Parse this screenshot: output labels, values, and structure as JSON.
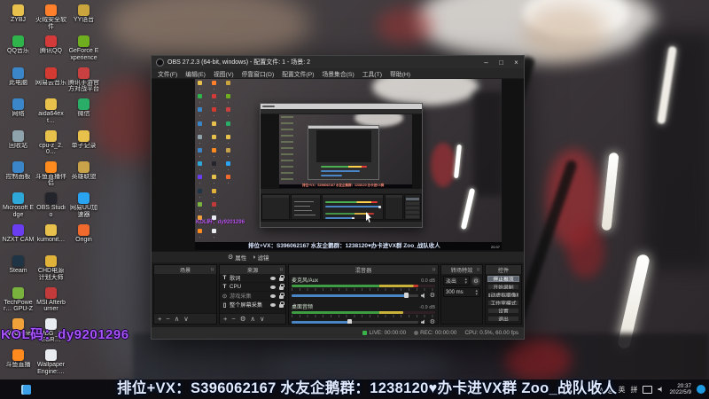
{
  "desktop": {
    "icons": [
      {
        "label": "ZYBJ",
        "color": "#e8c14d"
      },
      {
        "label": "QQ音乐",
        "color": "#2fb44c"
      },
      {
        "label": "此电脑",
        "color": "#3a86c8"
      },
      {
        "label": "网络",
        "color": "#3a86c8"
      },
      {
        "label": "回收站",
        "color": "#8fa3ad"
      },
      {
        "label": "控制面板",
        "color": "#3a86c8"
      },
      {
        "label": "Microsoft Edge",
        "color": "#2ea7d9"
      },
      {
        "label": "NZXT CAM",
        "color": "#6a3df0"
      },
      {
        "label": "Steam",
        "color": "#1f3445"
      },
      {
        "label": "TechPower… GPU-Z",
        "color": "#79b33e"
      },
      {
        "label": "WeGame",
        "color": "#f0a23a"
      },
      {
        "label": "斗鱼直播",
        "color": "#ff8a1e"
      },
      {
        "label": "火绒安全软件",
        "color": "#ff7f2a"
      },
      {
        "label": "腾讯QQ",
        "color": "#d43a3a"
      },
      {
        "label": "网易云音乐",
        "color": "#d33a31"
      },
      {
        "label": "aida64ext…",
        "color": "#e8c14d"
      },
      {
        "label": "cpu-z_2.0…",
        "color": "#e8c14d"
      },
      {
        "label": "斗鱼直播伴侣",
        "color": "#ff8a1e"
      },
      {
        "label": "OBS Studio",
        "color": "#24242c"
      },
      {
        "label": "kumonit…",
        "color": "#e8c14d"
      },
      {
        "label": "CHD电源计划大师",
        "color": "#e0b23a"
      },
      {
        "label": "MSI Afterburner",
        "color": "#c23a3a"
      },
      {
        "label": "PUBG _TLEGR…",
        "color": "#e9edf2"
      },
      {
        "label": "Wallpaper Engine:…",
        "color": "#e9edf2"
      },
      {
        "label": "YY语音",
        "color": "#caa53d"
      },
      {
        "label": "GeForce Experience",
        "color": "#6fae1f"
      },
      {
        "label": "腾讯手游官方对战平台",
        "color": "#c94040"
      },
      {
        "label": "微信",
        "color": "#2aae67"
      },
      {
        "label": "单子记录",
        "color": "#e8c14d"
      },
      {
        "label": "英雄联盟",
        "color": "#c9a34a"
      },
      {
        "label": "网易UU加速器",
        "color": "#2aa3f0"
      },
      {
        "label": "Origin",
        "color": "#f06a2d"
      }
    ],
    "kol_text": "KOL码：dy9201296"
  },
  "obs": {
    "title": "OBS 27.2.3 (64-bit, windows) - 配置文件: 1 - 场景: 2",
    "window_buttons": {
      "min": "–",
      "max": "□",
      "close": "×"
    },
    "menus": [
      "文件(F)",
      "编辑(E)",
      "视图(V)",
      "停靠窗口(D)",
      "配置文件(P)",
      "场景集合(S)",
      "工具(T)",
      "帮助(H)"
    ],
    "source_toolbar": {
      "properties": "属性",
      "filters": "滤镜",
      "properties_icon": "⚙",
      "filters_icon": "◑"
    },
    "scenes": {
      "header": "场景",
      "toolbar": [
        "+",
        "−",
        "∧",
        "∨"
      ]
    },
    "sources": {
      "header": "来源",
      "items": [
        {
          "name": "歌词",
          "glyph": "T",
          "color": "#d8d8d8"
        },
        {
          "name": "CPU",
          "glyph": "T",
          "color": "#d8d8d8"
        },
        {
          "name": "游戏采集",
          "glyph": "⊙",
          "color": "#8a8a8a"
        },
        {
          "name": "整个屏幕采集",
          "glyph": "▯",
          "color": "#d8d8d8"
        }
      ],
      "toolbar": [
        "+",
        "−",
        "⚙",
        "∧",
        "∨"
      ]
    },
    "mixer": {
      "header": "混音器",
      "channels": [
        {
          "name": "麦克风/Aux",
          "db": "0.0 dB",
          "meter_pct": "88%",
          "slider_pct": "91%"
        },
        {
          "name": "桌面音频",
          "db": "-0.9 dB",
          "meter_pct": "78%",
          "slider_pct": "46%"
        }
      ]
    },
    "transitions": {
      "header": "转场特效",
      "selected": "淡出",
      "duration": "300 ms"
    },
    "controls": {
      "header": "控件",
      "buttons": [
        {
          "label": "停止推流",
          "active": true
        },
        {
          "label": "开始录制",
          "active": false
        },
        {
          "label": "启动虚拟摄像机",
          "active": false
        },
        {
          "label": "工作室模式",
          "active": false
        },
        {
          "label": "设置",
          "active": false
        },
        {
          "label": "退出",
          "active": false
        }
      ]
    },
    "statusbar": {
      "live": "LIVE: 00:00:00",
      "rec": "REC: 00:00:00",
      "cpu": "CPU: 0.5%, 60.00 fps"
    }
  },
  "preview": {
    "overlay_text": "排位+VX：S396062167 水友企鹅群：1238120♥办卡进VX群 Zoo_战队收人",
    "kol_text": "KOL码：dy9201296",
    "mini_time": "20:37"
  },
  "taskbar": {
    "overlay_text": "排位+VX：S396062167 水友企鹅群：1238120♥办卡进VX群 Zoo_战队收人",
    "tray": {
      "chevron": "∧",
      "ime_lang": "英",
      "ime_mode": "拼",
      "time": "20:37",
      "date": "2022/5/9"
    }
  },
  "colors": {
    "accent_blue": "#4a86c5",
    "meter_green": "#3e9d42",
    "live_green": "#39b24a",
    "kol_purple": "#a855f7"
  }
}
